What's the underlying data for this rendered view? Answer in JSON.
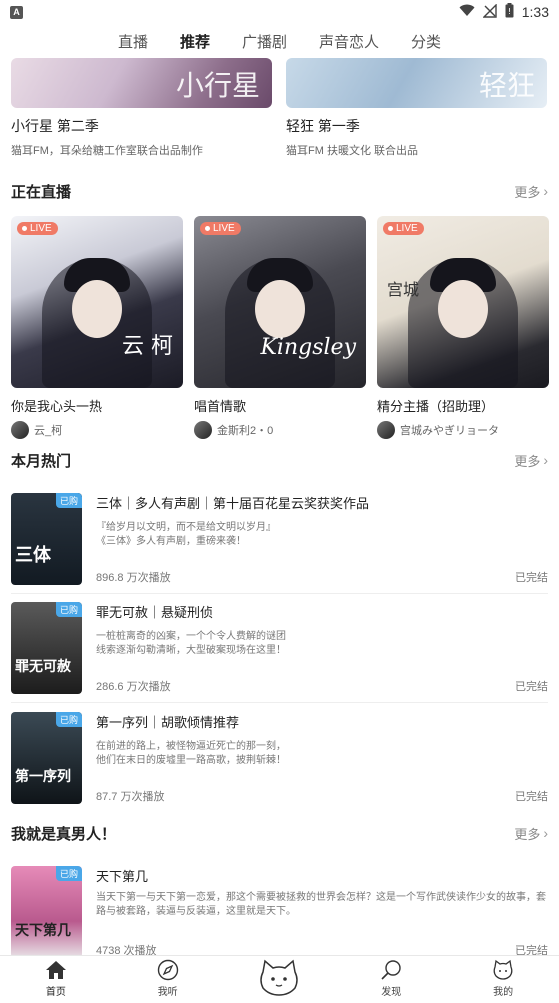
{
  "status_bar": {
    "app_badge": "A",
    "time": "1:33",
    "icons": [
      "wifi-icon",
      "no-signal-icon",
      "battery-icon"
    ]
  },
  "tabs": [
    {
      "label": "直播",
      "active": false
    },
    {
      "label": "推荐",
      "active": true
    },
    {
      "label": "广播剧",
      "active": false
    },
    {
      "label": "声音恋人",
      "active": false
    },
    {
      "label": "分类",
      "active": false
    }
  ],
  "banners": [
    {
      "title": "小行星 第二季",
      "subtitle": "猫耳FM，耳朵给糖工作室联合出品制作",
      "art_text": "小行星"
    },
    {
      "title": "轻狂 第一季",
      "subtitle": "猫耳FM 扶暖文化 联合出品",
      "art_text": "轻狂"
    }
  ],
  "live_section": {
    "title": "正在直播",
    "more_label": "更多",
    "badge_label": "LIVE",
    "items": [
      {
        "title": "你是我心头一热",
        "host": "云_柯",
        "art_text": "云 柯"
      },
      {
        "title": "唱首情歌",
        "host": "金斯利2・0",
        "art_text": "Kingsley"
      },
      {
        "title": "精分主播（招助理）",
        "host": "宫城みやぎリョータ",
        "art_text": "宫城"
      }
    ]
  },
  "hot_section": {
    "title": "本月热门",
    "more_label": "更多",
    "bought_label": "已购",
    "items": [
      {
        "title": "三体｜多人有声剧｜第十届百花星云奖获奖作品",
        "desc_line1": "『给岁月以文明，而不是给文明以岁月』",
        "desc_line2": "《三体》多人有声剧，重磅来袭！",
        "plays": "896.8 万次播放",
        "status": "已完结",
        "cover_text": "三体"
      },
      {
        "title": "罪无可赦｜悬疑刑侦",
        "desc_line1": "一桩桩离奇的凶案，一个个令人费解的谜团",
        "desc_line2": "线索逐渐勾勒清晰，大型破案现场在这里！",
        "plays": "286.6 万次播放",
        "status": "已完结",
        "cover_text": "罪无可赦"
      },
      {
        "title": "第一序列｜胡歌倾情推荐",
        "desc_line1": "在前进的路上，被怪物逼近死亡的那一刻，",
        "desc_line2": "他们在末日的废墟里一路高歌，披荆斩棘！",
        "plays": "87.7 万次播放",
        "status": "已完结",
        "cover_text": "第一序列"
      }
    ]
  },
  "men_section": {
    "title": "我就是真男人！",
    "more_label": "更多",
    "items": [
      {
        "title": "天下第几",
        "desc_line1": "当天下第一与天下第一恋爱，那这个需要被拯救的世界会怎样？这是一个写作武侠读作少女的故事，套路与被套路，装逼与反装逼，这里就是天下。",
        "plays": "4738 次播放",
        "status": "已完结",
        "cover_text": "天下第几"
      }
    ]
  },
  "bottom_nav": [
    {
      "label": "首页",
      "icon": "home-icon",
      "active": true
    },
    {
      "label": "我听",
      "icon": "compass-icon",
      "active": false
    },
    {
      "label": "",
      "icon": "cat-icon",
      "active": false
    },
    {
      "label": "发现",
      "icon": "discover-icon",
      "active": false
    },
    {
      "label": "我的",
      "icon": "profile-icon",
      "active": false
    }
  ]
}
